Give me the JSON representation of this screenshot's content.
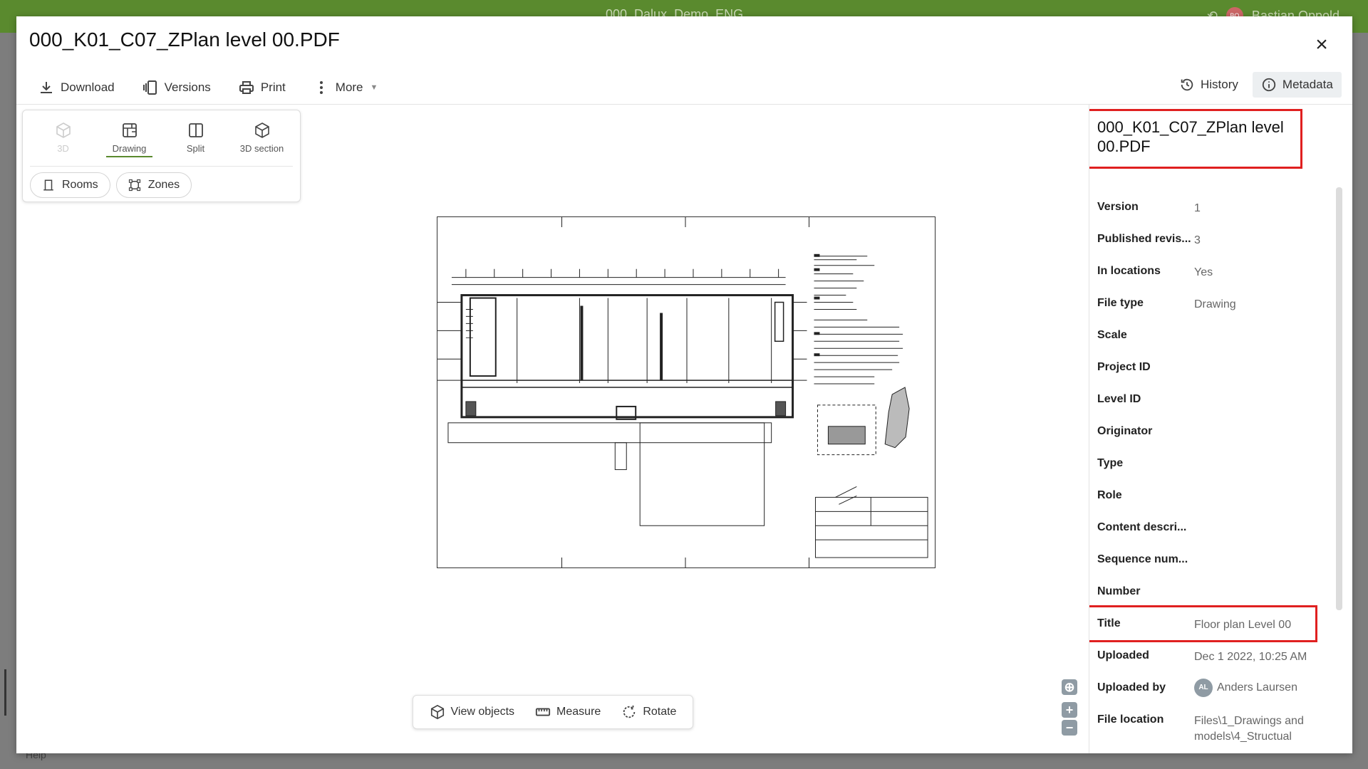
{
  "app": {
    "project_name": "000_Dalux_Demo_ENG",
    "user_initials": "BO",
    "user_name": "Bastian Oppold",
    "help_label": "Help"
  },
  "modal": {
    "title": "000_K01_C07_ZPlan level 00.PDF",
    "close_icon": "×"
  },
  "toolbar": {
    "download": "Download",
    "versions": "Versions",
    "print": "Print",
    "more": "More"
  },
  "tabs": {
    "history": "History",
    "metadata": "Metadata",
    "active": "metadata"
  },
  "view_modes": [
    {
      "id": "3d",
      "label": "3D",
      "icon": "cube-icon",
      "state": "disabled"
    },
    {
      "id": "drawing",
      "label": "Drawing",
      "icon": "drawing-icon",
      "state": "active"
    },
    {
      "id": "split",
      "label": "Split",
      "icon": "split-icon",
      "state": "normal"
    },
    {
      "id": "3d-section",
      "label": "3D section",
      "icon": "cube-section-icon",
      "state": "normal"
    }
  ],
  "filters": {
    "rooms": "Rooms",
    "zones": "Zones"
  },
  "bottom_toolbar": {
    "view_objects": "View objects",
    "measure": "Measure",
    "rotate": "Rotate"
  },
  "zoom": {
    "in": "+",
    "out": "−"
  },
  "metadata": {
    "title": "000_K01_C07_ZPlan level 00.PDF",
    "rows": [
      {
        "key": "Version",
        "value": "1"
      },
      {
        "key": "Published revis...",
        "value": "3"
      },
      {
        "key": "In locations",
        "value": "Yes"
      },
      {
        "key": "File type",
        "value": "Drawing"
      },
      {
        "key": "Scale",
        "value": ""
      },
      {
        "key": "Project ID",
        "value": ""
      },
      {
        "key": "Level ID",
        "value": ""
      },
      {
        "key": "Originator",
        "value": ""
      },
      {
        "key": "Type",
        "value": ""
      },
      {
        "key": "Role",
        "value": ""
      },
      {
        "key": "Content descri...",
        "value": ""
      },
      {
        "key": "Sequence num...",
        "value": ""
      },
      {
        "key": "Number",
        "value": ""
      },
      {
        "key": "Title",
        "value": "Floor plan Level 00"
      },
      {
        "key": "Uploaded",
        "value": "Dec 1 2022, 10:25 AM"
      },
      {
        "key": "Uploaded by",
        "value": "Anders Laursen",
        "initials": "AL"
      },
      {
        "key": "File location",
        "value": "Files\\1_Drawings and models\\4_Structual"
      }
    ]
  },
  "colors": {
    "brand_green": "#5a8a2e",
    "highlight_red": "#e02020"
  }
}
